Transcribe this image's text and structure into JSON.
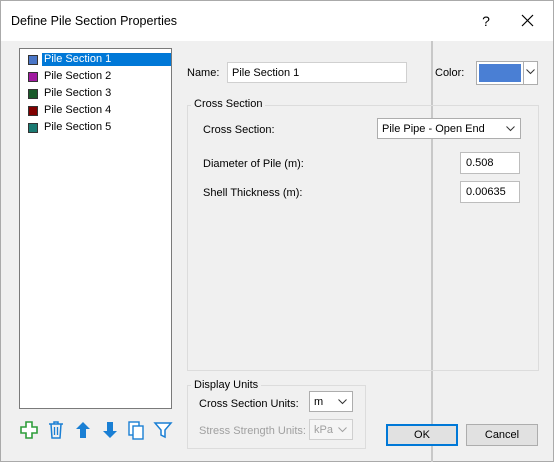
{
  "window": {
    "title": "Define Pile Section Properties",
    "help_label": "?"
  },
  "sections": [
    {
      "label": "Pile Section 1",
      "color": "#4a76c7",
      "selected": true
    },
    {
      "label": "Pile Section 2",
      "color": "#a01aa0",
      "selected": false
    },
    {
      "label": "Pile Section 3",
      "color": "#1a5a2a",
      "selected": false
    },
    {
      "label": "Pile Section 4",
      "color": "#800000",
      "selected": false
    },
    {
      "label": "Pile Section 5",
      "color": "#1a7a72",
      "selected": false
    }
  ],
  "toolbar": {
    "icons": [
      "add-icon",
      "delete-icon",
      "move-up-icon",
      "move-down-icon",
      "copy-icon",
      "filter-icon"
    ],
    "accent": "#1a7fd4",
    "add_color": "#2e9d3a"
  },
  "name_field": {
    "label": "Name:",
    "value": "Pile Section 1"
  },
  "color_field": {
    "label": "Color:",
    "value": "#4a7fd4"
  },
  "cross_section": {
    "group_title": "Cross Section",
    "type_label": "Cross Section:",
    "type_value": "Pile Pipe - Open End",
    "diameter_label": "Diameter of Pile (m):",
    "diameter_value": "0.508",
    "thickness_label": "Shell Thickness (m):",
    "thickness_value": "0.00635"
  },
  "display_units": {
    "group_title": "Display Units",
    "cross_section_units_label": "Cross Section Units:",
    "cross_section_units_value": "m",
    "stress_units_label": "Stress Strength Units:",
    "stress_units_value": "kPa"
  },
  "buttons": {
    "ok": "OK",
    "cancel": "Cancel"
  }
}
